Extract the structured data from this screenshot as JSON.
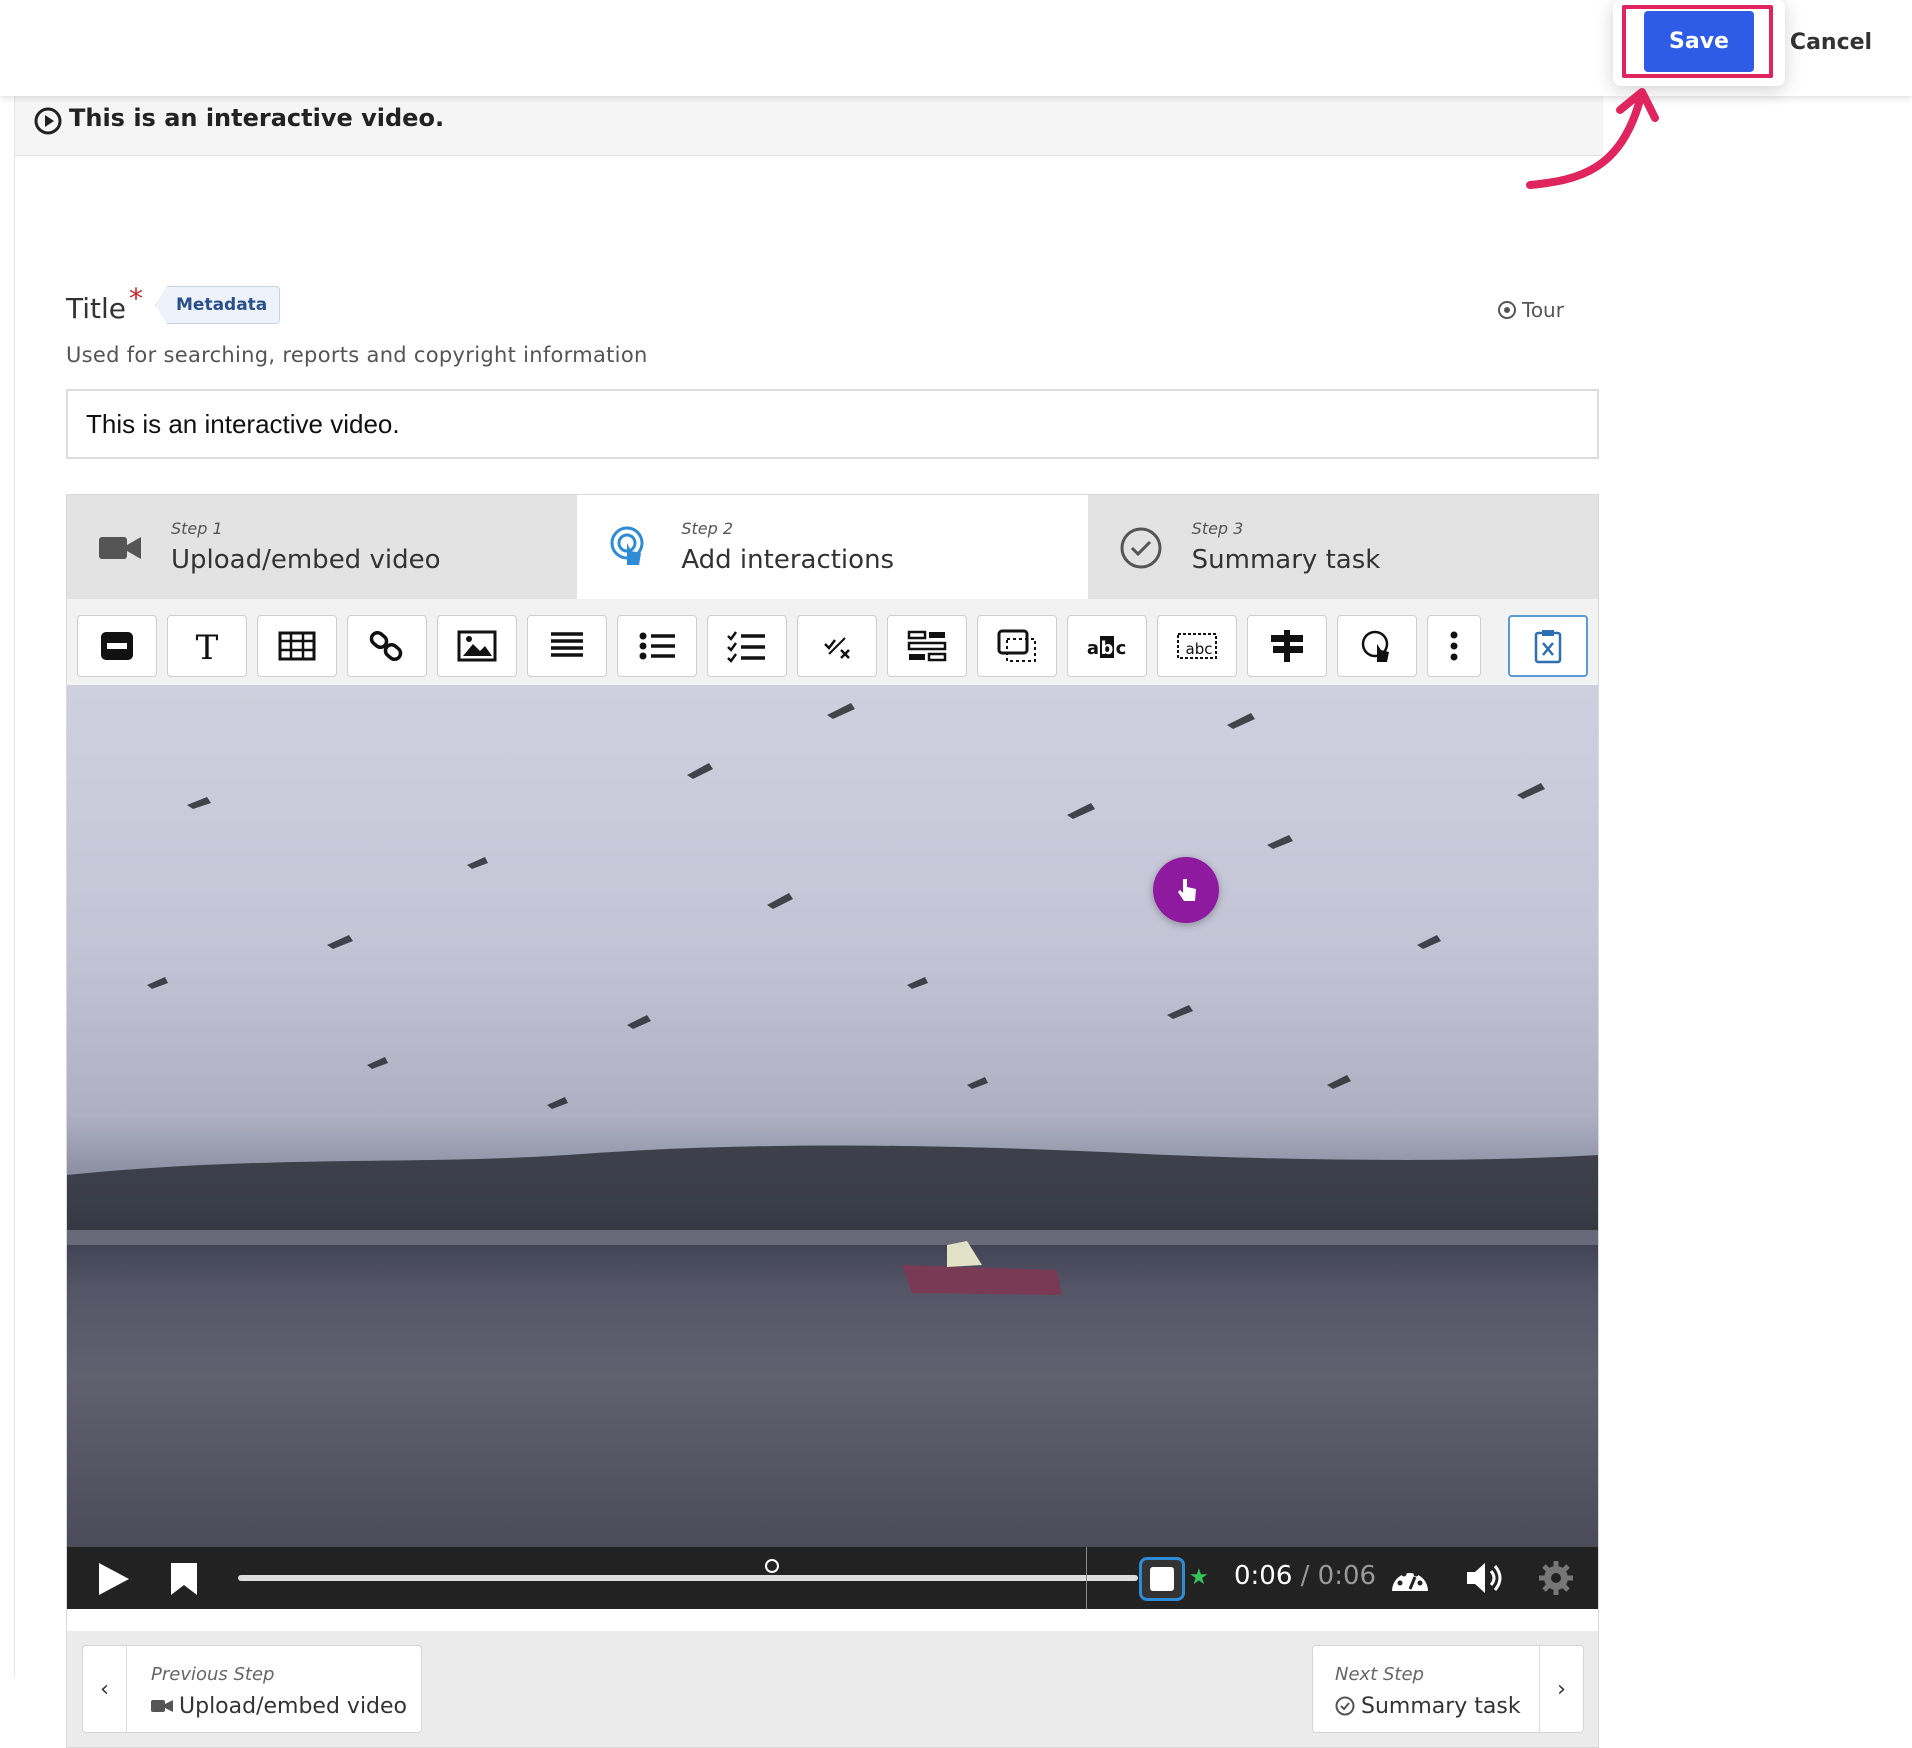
{
  "topbar": {
    "save_label": "Save",
    "cancel_label": "Cancel"
  },
  "content": {
    "header_title": "This is an interactive video."
  },
  "form": {
    "title_label": "Title",
    "required_mark": "*",
    "metadata_label": "Metadata",
    "tour_label": "Tour",
    "description": "Used for searching, reports and copyright information",
    "title_value": "This is an interactive video."
  },
  "steps": [
    {
      "number": "Step 1",
      "label": "Upload/embed video",
      "icon": "video-camera-icon"
    },
    {
      "number": "Step 2",
      "label": "Add interactions",
      "icon": "touch-icon"
    },
    {
      "number": "Step 3",
      "label": "Summary task",
      "icon": "check-circle-icon"
    }
  ],
  "toolbar": {
    "tools": [
      "label-icon",
      "text-icon",
      "table-icon",
      "link-icon",
      "image-icon",
      "statements-icon",
      "single-choice-icon",
      "multiple-choice-icon",
      "true-false-icon",
      "drag-and-drop-icon",
      "navigation-hotspot-icon",
      "mark-words-icon",
      "fill-in-blanks-icon",
      "crossroads-icon",
      "goto-icon",
      "more-icon",
      "paste-icon"
    ]
  },
  "player": {
    "current_time": "0:06",
    "duration": "/ 0:06",
    "progress": 1.0
  },
  "navigation": {
    "previous_sub": "Previous Step",
    "previous_label": "Upload/embed video",
    "next_sub": "Next Step",
    "next_label": "Summary task"
  },
  "colors": {
    "save": "#2f5ce6",
    "highlight": "#e0245e",
    "hotspot": "#8e1aa0"
  }
}
